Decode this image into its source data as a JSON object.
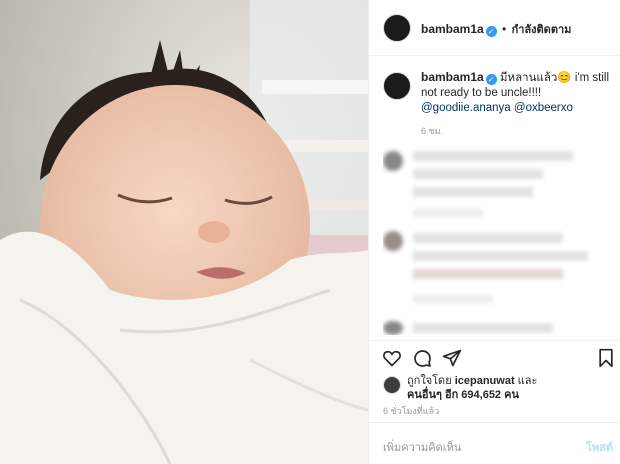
{
  "post": {
    "username": "bambam1a",
    "follow_status": "กำลังติดตาม",
    "separator": "•",
    "caption": {
      "text_start": "มีหลานแล้ว",
      "emoji": "😊",
      "text_end": " i'm still not ready to be uncle!!!!",
      "mention_1": "@goodiie.ananya",
      "mention_2": "@oxbeerxo",
      "time": "6 ชม."
    },
    "likes": {
      "prefix": "ถูกใจโดย",
      "user": "icepanuwat",
      "conj": "และ",
      "others_label": "คนอื่นๆ อีก 694,652 คน"
    },
    "post_time": "6 ชั่วโมงที่แล้ว",
    "comment_placeholder": "เพิ่มความคิดเห็น",
    "post_button": "โพสต์"
  },
  "icons": {
    "verified": "verified-badge-icon",
    "like": "heart-icon",
    "comment": "comment-icon",
    "share": "share-icon",
    "save": "bookmark-icon"
  },
  "colors": {
    "verified": "#3897f0",
    "mention": "#003569",
    "post_button_disabled": "#b2dffc"
  }
}
